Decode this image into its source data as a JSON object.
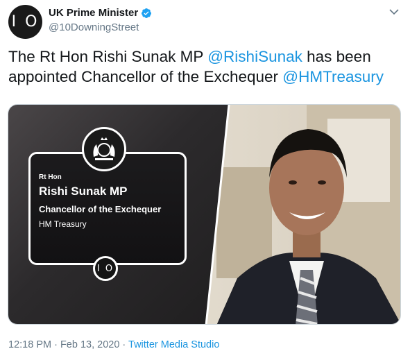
{
  "author": {
    "display_name": "UK Prime Minister",
    "handle": "@10DowningStreet",
    "avatar_mark": "I O",
    "verified": true
  },
  "tweet": {
    "text_1": "The Rt Hon Rishi Sunak MP ",
    "mention_1": "@RishiSunak",
    "text_2": " has been appointed Chancellor of the Exchequer ",
    "mention_2": "@HMTreasury"
  },
  "media": {
    "card_honorific": "Rt Hon",
    "card_name": "Rishi Sunak MP",
    "card_role": "Chancellor of the Exchequer",
    "card_department": "HM Treasury",
    "card_logo_mark": "I O"
  },
  "footer": {
    "timestamp": "12:18 PM · Feb 13, 2020 · ",
    "source": "Twitter Media Studio"
  },
  "colors": {
    "link": "#1b95e0",
    "secondary_text": "#657786",
    "verified_badge": "#1da1f2"
  },
  "icons": {
    "verified": "verified-badge-icon",
    "menu": "chevron-down-icon"
  }
}
